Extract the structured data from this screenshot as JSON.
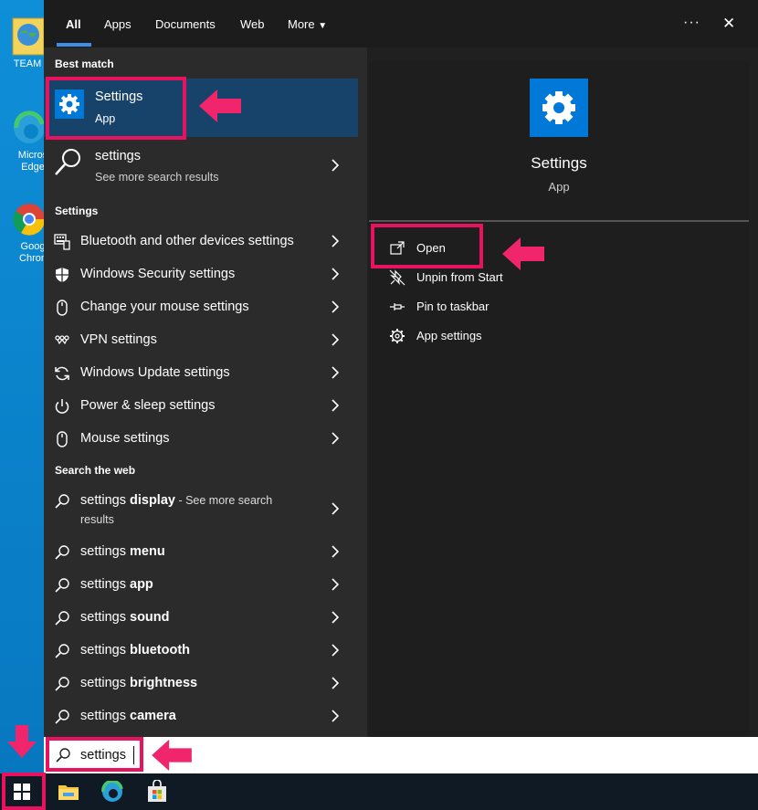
{
  "desktop": {
    "icons": [
      {
        "label": "TEAM"
      },
      {
        "label": "Micros Edge"
      },
      {
        "label": "Goog Chron"
      }
    ]
  },
  "tabs": [
    {
      "label": "All",
      "active": true
    },
    {
      "label": "Apps"
    },
    {
      "label": "Documents"
    },
    {
      "label": "Web"
    },
    {
      "label": "More"
    }
  ],
  "topbar": {
    "more_options": "···",
    "close": "✕"
  },
  "best_match": {
    "header": "Best match",
    "title": "Settings",
    "subtitle": "App"
  },
  "web_result_top": {
    "title": "settings",
    "subtitle": "See more search results"
  },
  "settings_section": {
    "header": "Settings",
    "items": [
      {
        "label": "Bluetooth and other devices settings",
        "icon": "keyboard-icon"
      },
      {
        "label": "Windows Security settings",
        "icon": "shield-icon"
      },
      {
        "label": "Change your mouse settings",
        "icon": "mouse-icon"
      },
      {
        "label": "VPN settings",
        "icon": "vpn-icon"
      },
      {
        "label": "Windows Update settings",
        "icon": "refresh-icon"
      },
      {
        "label": "Power & sleep settings",
        "icon": "power-icon"
      },
      {
        "label": "Mouse settings",
        "icon": "mouse-icon"
      }
    ]
  },
  "web_section": {
    "header": "Search the web",
    "first": {
      "prefix": "settings ",
      "bold": "display",
      "suffix": " - See more search",
      "line2": "results"
    },
    "items": [
      {
        "prefix": "settings ",
        "bold": "menu"
      },
      {
        "prefix": "settings ",
        "bold": "app"
      },
      {
        "prefix": "settings ",
        "bold": "sound"
      },
      {
        "prefix": "settings ",
        "bold": "bluetooth"
      },
      {
        "prefix": "settings ",
        "bold": "brightness"
      },
      {
        "prefix": "settings ",
        "bold": "camera"
      }
    ]
  },
  "preview": {
    "title": "Settings",
    "subtitle": "App",
    "actions": [
      {
        "label": "Open",
        "icon": "open-icon"
      },
      {
        "label": "Unpin from Start",
        "icon": "unpin-icon"
      },
      {
        "label": "Pin to taskbar",
        "icon": "pin-icon"
      },
      {
        "label": "App settings",
        "icon": "gear-icon"
      }
    ]
  },
  "search": {
    "value": "settings"
  },
  "colors": {
    "accent": "#0078d7",
    "highlight": "#e8125f",
    "selected": "#17436a"
  }
}
